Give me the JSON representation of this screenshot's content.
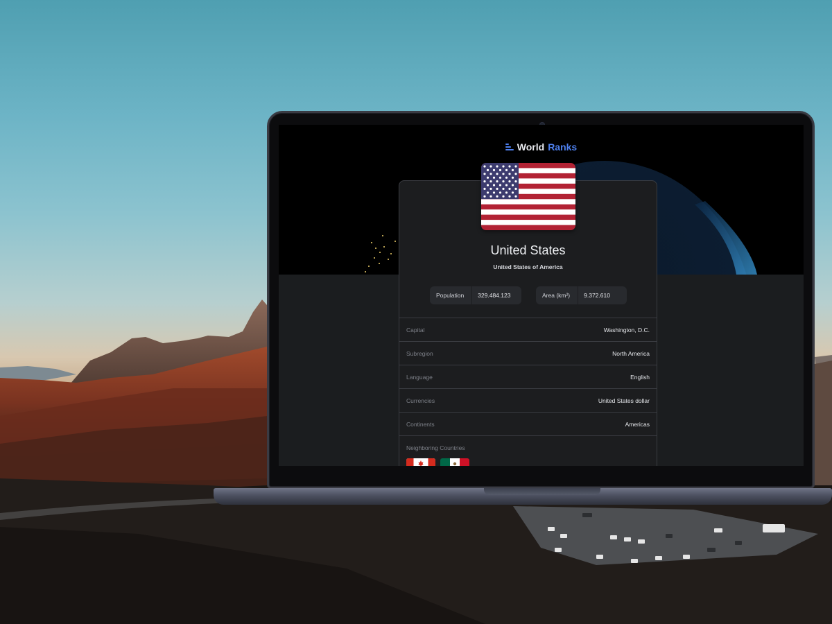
{
  "app": {
    "logo_word1": "World",
    "logo_word2": "Ranks",
    "accent_color": "#4e80ee"
  },
  "country": {
    "name": "United States",
    "official_name": "United States of America",
    "flag_icon": "us-flag-icon",
    "stats": {
      "population_label": "Population",
      "population_value": "329.484.123",
      "area_label": "Area (km²)",
      "area_value": "9.372.610"
    },
    "details": [
      {
        "label": "Capital",
        "value": "Washington, D.C."
      },
      {
        "label": "Subregion",
        "value": "North America"
      },
      {
        "label": "Language",
        "value": "English"
      },
      {
        "label": "Currencies",
        "value": "United States dollar"
      },
      {
        "label": "Continents",
        "value": "Americas"
      }
    ],
    "neighbors_label": "Neighboring Countries",
    "neighbor_flags": [
      "canada-flag-icon",
      "mexico-flag-icon"
    ]
  }
}
